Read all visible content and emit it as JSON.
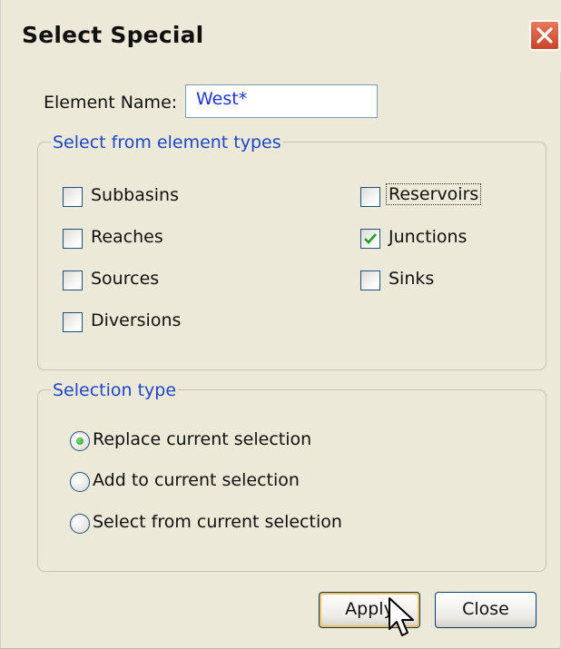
{
  "window": {
    "title": "Select Special"
  },
  "element_name": {
    "label": "Element Name:",
    "value": "West*"
  },
  "element_types": {
    "legend": "Select from element types",
    "items": [
      {
        "label": "Subbasins",
        "checked": false
      },
      {
        "label": "Reaches",
        "checked": false
      },
      {
        "label": "Sources",
        "checked": false
      },
      {
        "label": "Diversions",
        "checked": false
      },
      {
        "label": "Reservoirs",
        "checked": false
      },
      {
        "label": "Junctions",
        "checked": true
      },
      {
        "label": "Sinks",
        "checked": false
      }
    ]
  },
  "selection_type": {
    "legend": "Selection type",
    "options": [
      {
        "label": "Replace current selection",
        "selected": true
      },
      {
        "label": "Add to current selection",
        "selected": false
      },
      {
        "label": "Select from current selection",
        "selected": false
      }
    ]
  },
  "buttons": {
    "apply": "Apply",
    "close": "Close"
  },
  "icons": {
    "close": "close-icon",
    "check": "checkmark-icon",
    "cursor": "arrow-cursor-icon"
  }
}
